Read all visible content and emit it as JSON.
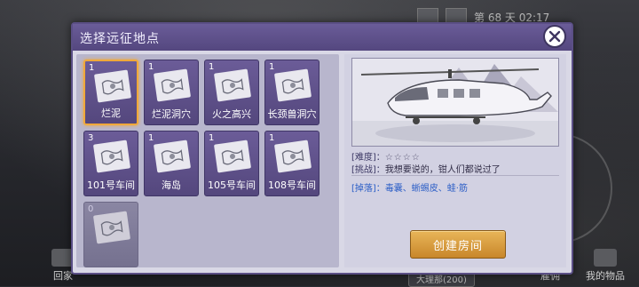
{
  "dialog": {
    "title": "选择远征地点",
    "close_icon": "close-x-icon"
  },
  "locations": [
    {
      "count": "1",
      "name": "烂泥",
      "selected": true,
      "locked": false,
      "icon": "map-scroll-icon"
    },
    {
      "count": "1",
      "name": "烂泥洞穴",
      "selected": false,
      "locked": false,
      "icon": "map-scroll-icon"
    },
    {
      "count": "1",
      "name": "火之高兴",
      "selected": false,
      "locked": false,
      "icon": "map-scroll-icon"
    },
    {
      "count": "1",
      "name": "长颈兽洞穴",
      "selected": false,
      "locked": false,
      "icon": "map-scroll-icon"
    },
    {
      "count": "3",
      "name": "101号车间",
      "selected": false,
      "locked": false,
      "icon": "map-scroll-icon"
    },
    {
      "count": "1",
      "name": "海岛",
      "selected": false,
      "locked": false,
      "icon": "map-scroll-icon"
    },
    {
      "count": "1",
      "name": "105号车间",
      "selected": false,
      "locked": false,
      "icon": "map-scroll-icon"
    },
    {
      "count": "1",
      "name": "108号车间",
      "selected": false,
      "locked": false,
      "icon": "map-scroll-icon"
    },
    {
      "count": "0",
      "name": "",
      "selected": false,
      "locked": true,
      "icon": "map-scroll-icon"
    }
  ],
  "info": {
    "difficulty_label": "[难度]：",
    "difficulty_stars": "☆☆☆☆",
    "challenge_label": "[挑战]：",
    "challenge_text": "我想要说的，钳人们都说过了",
    "drops_label": "[掉落]：",
    "drops_text": "毒囊、蜥蜴皮、蛙·筋"
  },
  "create_button": "创建房间",
  "background": {
    "top_hud": "第 68 天 02:17",
    "home_label": "回家",
    "hire_label": "雇佣",
    "items_label": "我的物品",
    "center_label": "大理那(200)"
  },
  "colors": {
    "header": "#5e5089",
    "tile": "#5f5189",
    "selected_border": "#f0a93a",
    "button": "#d99a3e",
    "drops_text": "#2d5fc7"
  }
}
